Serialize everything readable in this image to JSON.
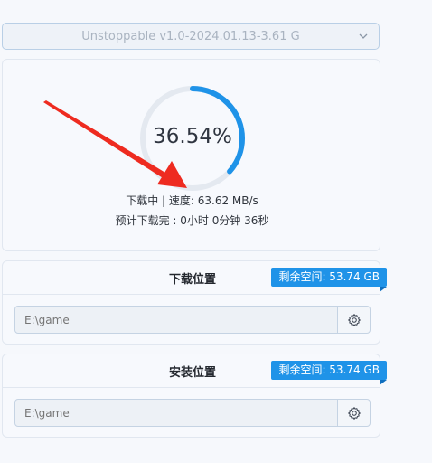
{
  "version_select": {
    "value": "Unstoppable v1.0-2024.01.13-3.61 G"
  },
  "progress": {
    "percent_text": "36.54%",
    "fraction": 0.3654,
    "status_line": "下载中 | 速度:  63.62 MB/s",
    "eta_line": "预计下载完 : 0小时 0分钟 36秒"
  },
  "download_location": {
    "title": "下载位置",
    "free_space": "剩余空间:  53.74 GB",
    "path_placeholder": "E:\\game"
  },
  "install_location": {
    "title": "安装位置",
    "free_space": "剩余空间:  53.74 GB",
    "path_placeholder": "E:\\game"
  },
  "colors": {
    "accent": "#1f93e8",
    "ring_track": "#e4e9f0",
    "annotation": "#ee2b20"
  },
  "icons": {
    "dropdown": "chevron-down-icon",
    "settings": "gear-icon"
  }
}
